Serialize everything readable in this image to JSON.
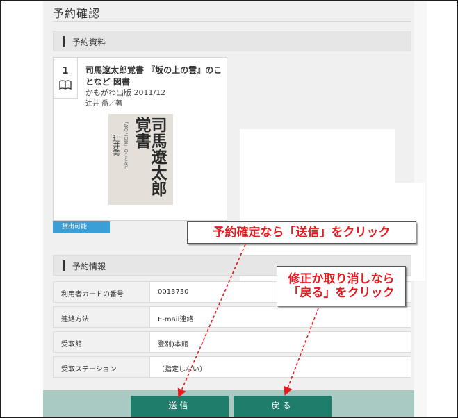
{
  "page": {
    "title": "予約確認"
  },
  "reservation_material": {
    "heading": "予約資料",
    "item": {
      "number": "1",
      "title": "司馬遼太郎覚書 『坂の上の雲』のことなど 図書",
      "publisher_line": "かもがわ出版 2011/12",
      "author_line": "辻井 喬／著",
      "status": "貸出可能",
      "cover": {
        "title": "司馬遼太郎覚書",
        "subtitle": "「坂の上の雲」のことなど",
        "author": "辻井喬"
      }
    }
  },
  "reservation_info": {
    "heading": "予約情報",
    "rows": [
      {
        "label": "利用者カードの番号",
        "value": "0013730"
      },
      {
        "label": "連絡方法",
        "value": "E-mail連絡"
      },
      {
        "label": "受取館",
        "value": "登別)本館"
      },
      {
        "label": "受取ステーション",
        "value": "（指定しない）"
      }
    ]
  },
  "buttons": {
    "submit": "送信",
    "back": "戻る"
  },
  "annotations": {
    "submit_hint": "予約確定なら「送信」をクリック",
    "back_hint_line1": "修正か取り消しなら",
    "back_hint_line2": "「戻る」をクリック"
  },
  "colors": {
    "accent_button": "#1e7d6b",
    "footer": "#a9cac2",
    "status_badge": "#3a9fd6",
    "annotation_text": "#e8191f",
    "annotation_arrow": "#e8191f"
  },
  "icons": {
    "book": "open-book-icon"
  }
}
